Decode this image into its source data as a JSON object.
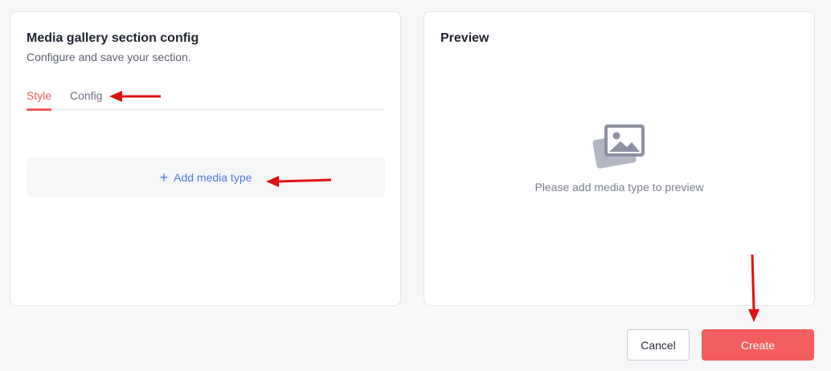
{
  "config_panel": {
    "title": "Media gallery section config",
    "subtitle": "Configure and save your section.",
    "tabs": [
      {
        "label": "Style",
        "active": true
      },
      {
        "label": "Config",
        "active": false
      }
    ],
    "add_media": {
      "icon": "plus-icon",
      "label": "Add media type"
    }
  },
  "preview_panel": {
    "title": "Preview",
    "empty_icon": "image-stack-icon",
    "empty_text": "Please add media type to preview"
  },
  "footer": {
    "cancel_label": "Cancel",
    "create_label": "Create"
  },
  "colors": {
    "accent": "#f45d5d",
    "link": "#4f78e0",
    "annotation_arrow": "#e01010"
  }
}
